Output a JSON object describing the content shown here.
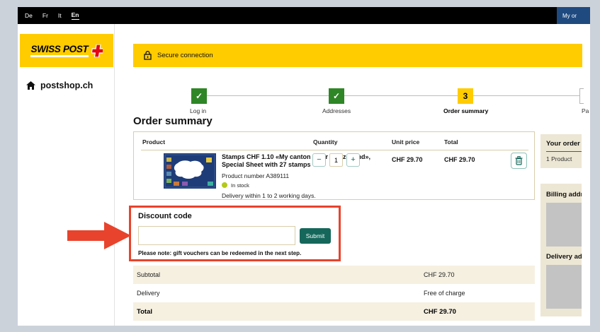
{
  "topbar": {
    "languages": [
      {
        "label": "De"
      },
      {
        "label": "Fr"
      },
      {
        "label": "It"
      },
      {
        "label": "En"
      }
    ],
    "account_button": "My or"
  },
  "sidebar": {
    "logo_text": "SWISS POST",
    "home_label": "postshop.ch"
  },
  "banner": {
    "label": "Secure connection"
  },
  "steps": {
    "items": [
      {
        "label": "Log in",
        "symbol": "✓",
        "state": "done"
      },
      {
        "label": "Addresses",
        "symbol": "✓",
        "state": "done"
      },
      {
        "label": "Order summary",
        "symbol": "3",
        "state": "current"
      },
      {
        "label": "Pa",
        "symbol": "",
        "state": "upcoming"
      }
    ]
  },
  "order": {
    "heading": "Order summary",
    "columns": [
      "Product",
      "Quantity",
      "Unit price",
      "Total"
    ],
    "item": {
      "title": "Stamps CHF 1.10 «My canton – our Switzerland», Special Sheet with 27 stamps",
      "product_number": "Product number A389111",
      "stock": "In stock",
      "delivery": "Delivery within 1 to 2 working days.",
      "quantity": "1",
      "minus": "−",
      "plus": "+",
      "unit_price": "CHF 29.70",
      "total": "CHF 29.70"
    },
    "totals": [
      {
        "label": "Subtotal",
        "value": "CHF 29.70"
      },
      {
        "label": "Delivery",
        "value": "Free of charge"
      },
      {
        "label": "Total",
        "value": "CHF 29.70"
      }
    ]
  },
  "discount": {
    "heading": "Discount code",
    "input_value": "",
    "submit_label": "Submit",
    "note": "Please note: gift vouchers can be redeemed in the next step."
  },
  "aside": {
    "your_order_title": "Your order",
    "your_order_line": "1  Product",
    "billing_title": "Billing addre",
    "delivery_title": "Delivery add"
  },
  "colors": {
    "brand_yellow": "#ffcc00",
    "teal_accent": "#15675b",
    "step_green": "#2f8626",
    "annotation_red": "#e8432c",
    "beige_row": "#f6f0e1",
    "beige_panel": "#ece6d4",
    "navy_button": "#1e4a80"
  }
}
